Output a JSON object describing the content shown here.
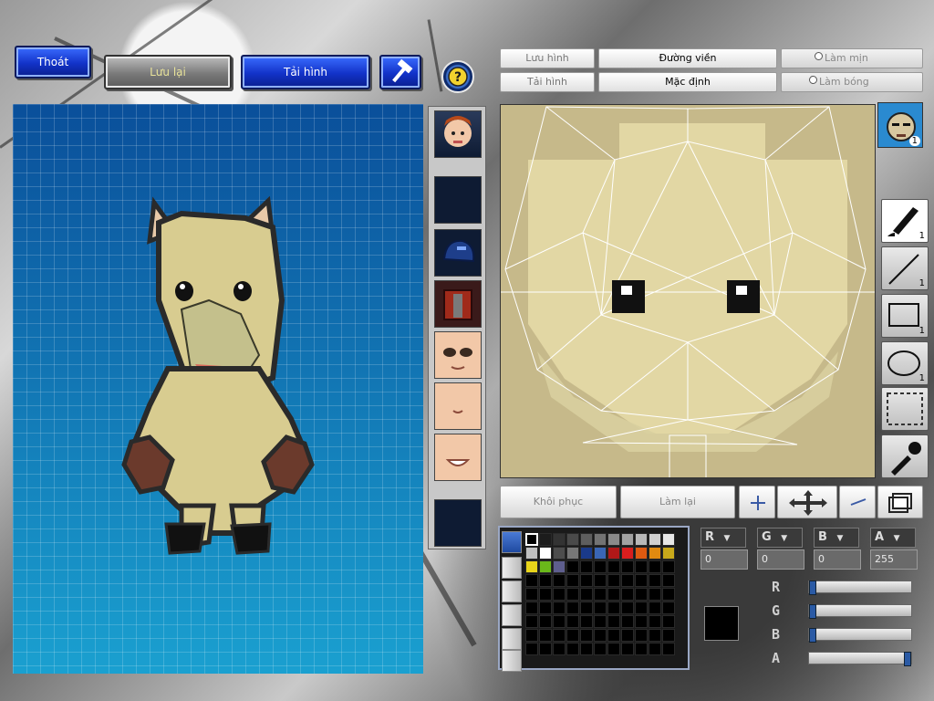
{
  "top_left": {
    "exit_label": "Thoát",
    "save_label": "Lưu lại",
    "load_label": "Tải hình"
  },
  "editor_tabs": {
    "save_image": "Lưu hình",
    "load_image": "Tải hình",
    "outline": "Đường viền",
    "default": "Mặc định",
    "smooth": "Làm mịn",
    "shade": "Làm bóng"
  },
  "tools": [
    {
      "icon": "brush-icon",
      "count": "1",
      "active": true
    },
    {
      "icon": "line-icon",
      "count": "1",
      "active": false
    },
    {
      "icon": "rectangle-icon",
      "count": "1",
      "active": false
    },
    {
      "icon": "ellipse-icon",
      "count": "1",
      "active": false
    },
    {
      "icon": "select-icon",
      "count": "",
      "active": false
    },
    {
      "icon": "eyedropper-icon",
      "count": "",
      "active": false
    }
  ],
  "avatar_badge": "1",
  "actions": {
    "restore_label": "Khôi phục",
    "redo_label": "Làm lại"
  },
  "channels": {
    "r_label": "R",
    "g_label": "G",
    "b_label": "B",
    "a_label": "A",
    "r_value": "0",
    "g_value": "0",
    "b_value": "0",
    "a_value": "255"
  },
  "sliders": {
    "r": 0,
    "g": 0,
    "b": 0,
    "a": 1
  },
  "current_color": "#000000",
  "palette_row1": [
    "#000000",
    "#1c1c1c",
    "#333333",
    "#4a4a4a",
    "#5e5e5e",
    "#737373",
    "#8a8a8a",
    "#a1a1a1",
    "#b8b8b8",
    "#d0d0d0",
    "#e6e6e6"
  ],
  "palette_row2": [
    "#c0c0c0",
    "#ffffff",
    "#4d4d4d",
    "#777777",
    "#1a3a8a",
    "#3a66b5",
    "#b01818",
    "#d91e1e",
    "#e05a10",
    "#e08a10",
    "#c8a81a"
  ],
  "palette_row3": [
    "#e8d41a",
    "#6ab81a",
    "#5e5e8e"
  ],
  "colors": {
    "preview_bg": "#0b7fb5",
    "editor_fill": "#c6b98a",
    "accent_blue": "#1232c8"
  }
}
